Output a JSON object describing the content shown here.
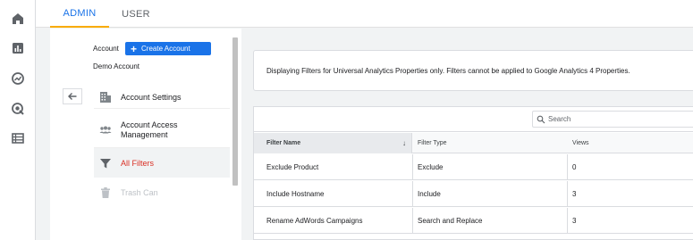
{
  "rail": {
    "icons": [
      "home-icon",
      "reports-icon",
      "explore-icon",
      "advertising-icon",
      "configure-icon"
    ]
  },
  "tabs": [
    {
      "label": "ADMIN",
      "active": true
    },
    {
      "label": "USER",
      "active": false
    }
  ],
  "account": {
    "label": "Account",
    "create_button": "Create Account",
    "name": "Demo Account"
  },
  "nav": {
    "items": [
      {
        "label": "Account Settings",
        "icon": "building-icon"
      },
      {
        "label": "Account Access Management",
        "icon": "people-icon"
      },
      {
        "label": "All Filters",
        "icon": "filter-icon",
        "active": true
      },
      {
        "label": "Trash Can",
        "icon": "trash-icon",
        "disabled": true
      }
    ]
  },
  "notice": "Displaying Filters for Universal Analytics Properties only. Filters cannot be applied to Google Analytics 4 Properties.",
  "table": {
    "search_placeholder": "Search",
    "headers": {
      "name": "Filter Name",
      "type": "Filter Type",
      "views": "Views",
      "sort": "↓"
    },
    "rows": [
      {
        "name": "Exclude Product",
        "type": "Exclude",
        "views": "0"
      },
      {
        "name": "Include Hostname",
        "type": "Include",
        "views": "3"
      },
      {
        "name": "Rename AdWords Campaigns",
        "type": "Search and Replace",
        "views": "3"
      }
    ]
  },
  "colors": {
    "accent": "#1a73e8",
    "active_nav": "#d93025",
    "tab_underline": "#f9ab00"
  }
}
